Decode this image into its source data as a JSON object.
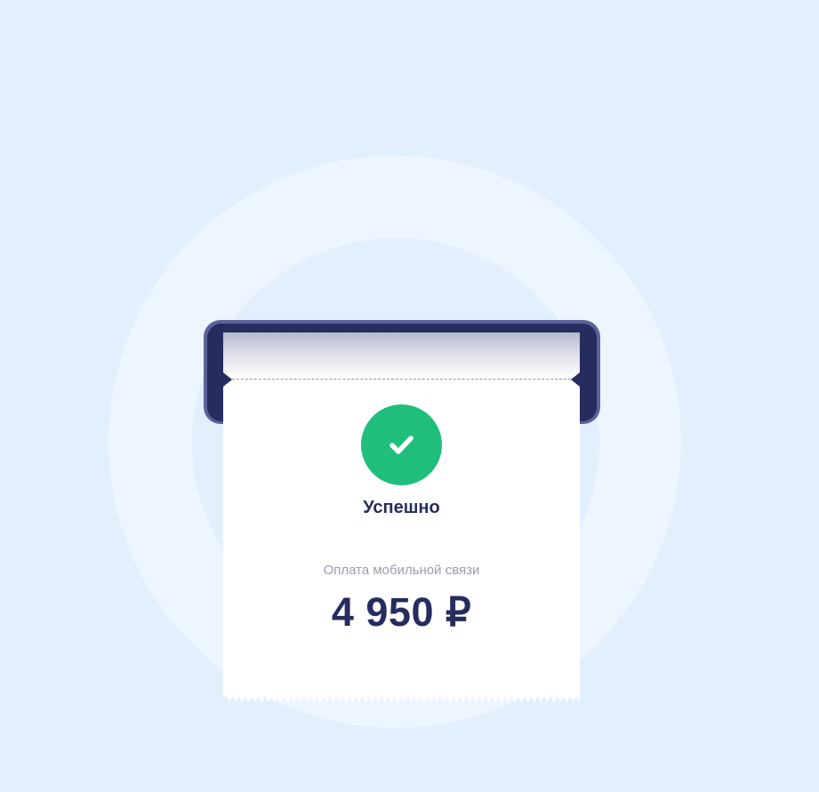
{
  "receipt": {
    "status": "Успешно",
    "payment_type": "Оплата мобильной связи",
    "amount": "4 950 ₽"
  },
  "icons": {
    "status_icon": "check-icon"
  },
  "colors": {
    "background": "#e2effd",
    "printer": "#262c5e",
    "printer_frame": "#5b6299",
    "success": "#1fbf7b",
    "text_primary": "#262c5e",
    "text_secondary": "#9a9daf"
  }
}
